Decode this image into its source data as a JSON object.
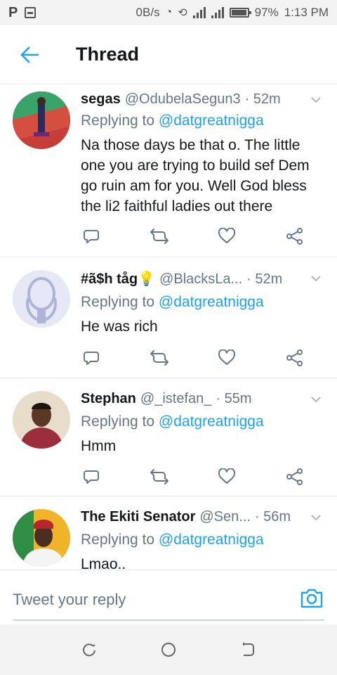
{
  "status_bar": {
    "app_icon": "P",
    "speed": "0B/s",
    "battery": "97%",
    "time": "1:13 PM"
  },
  "header": {
    "title": "Thread"
  },
  "tweets": [
    {
      "name": "segas",
      "handle": "@OdubelaSegun3",
      "time": "· 52m",
      "replying_label": "Replying to",
      "replying_to": "@datgreatnigga",
      "text": "Na those days be that o. The little one you are trying to build sef Dem go ruin am for you. Well God bless the li2 faithful ladies out there"
    },
    {
      "name": "#ã$h tåg💡",
      "handle": "@BlacksLa...",
      "time": "· 52m",
      "replying_label": "Replying to",
      "replying_to": "@datgreatnigga",
      "text": "He was rich"
    },
    {
      "name": "Stephan",
      "handle": "@_istefan_",
      "time": "· 55m",
      "replying_label": "Replying to",
      "replying_to": "@datgreatnigga",
      "text": "Hmm"
    },
    {
      "name": "The Ekiti Senator",
      "handle": "@Sen...",
      "time": "· 56m",
      "replying_label": "Replying to",
      "replying_to": "@datgreatnigga",
      "text": "Lmao.."
    }
  ],
  "composer": {
    "placeholder": "Tweet your reply"
  },
  "icons": {
    "back": "arrow-left-icon",
    "caret": "chevron-down-icon",
    "reply": "reply-icon",
    "retweet": "retweet-icon",
    "like": "heart-icon",
    "share": "share-icon",
    "camera": "camera-icon"
  },
  "colors": {
    "accent": "#1da1f2",
    "secondary_text": "#657786",
    "primary_text": "#14171a"
  }
}
